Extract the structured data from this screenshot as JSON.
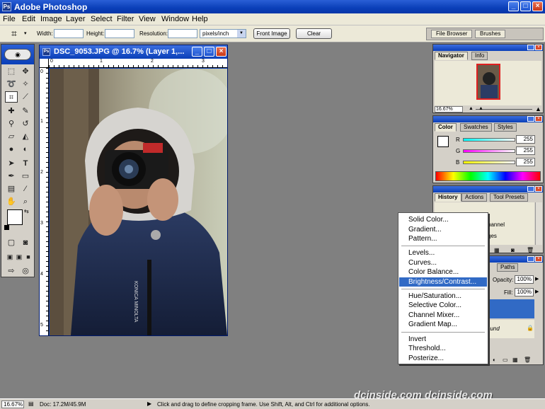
{
  "app": {
    "title": "Adobe Photoshop",
    "icon_text": "Ps"
  },
  "window_controls": {
    "minimize": "_",
    "maximize": "□",
    "close": "×"
  },
  "menu": [
    "File",
    "Edit",
    "Image",
    "Layer",
    "Select",
    "Filter",
    "View",
    "Window",
    "Help"
  ],
  "options": {
    "width_label": "Width:",
    "width_value": "",
    "height_label": "Height:",
    "height_value": "",
    "resolution_label": "Resolution:",
    "resolution_value": "",
    "units_selected": "pixels/inch",
    "front_image_label": "Front Image",
    "clear_label": "Clear",
    "well_tabs": [
      "File Browser",
      "Brushes"
    ]
  },
  "document": {
    "title": "DSC_9053.JPG @ 16.7% (Layer 1,...",
    "ruler_h": [
      "0",
      "1",
      "2",
      "3"
    ],
    "ruler_v": [
      "0",
      "1",
      "2",
      "3",
      "4",
      "5"
    ]
  },
  "navigator": {
    "tabs": [
      "Navigator",
      "Info"
    ],
    "zoom": "16.67%"
  },
  "color": {
    "tabs": [
      "Color",
      "Swatches",
      "Styles"
    ],
    "r_label": "R",
    "g_label": "G",
    "b_label": "B",
    "r": "255",
    "g": "255",
    "b": "255"
  },
  "history": {
    "tabs": [
      "History",
      "Actions",
      "Tool Presets"
    ],
    "rows": [
      "hannel",
      "ges"
    ]
  },
  "layers": {
    "tabs": [
      "Paths"
    ],
    "opacity_label": "Opacity:",
    "opacity": "100%",
    "fill_label": "Fill:",
    "fill": "100%",
    "bg_label": "ound"
  },
  "adjustment_menu": {
    "groups": [
      [
        "Solid Color...",
        "Gradient...",
        "Pattern..."
      ],
      [
        "Levels...",
        "Curves...",
        "Color Balance...",
        "Brightness/Contrast..."
      ],
      [
        "Hue/Saturation...",
        "Selective Color...",
        "Channel Mixer...",
        "Gradient Map..."
      ],
      [
        "Invert",
        "Threshold...",
        "Posterize..."
      ]
    ],
    "highlighted": "Brightness/Contrast..."
  },
  "status": {
    "zoom": "16.67%",
    "doc": "Doc: 17.2M/45.9M",
    "arrow": "▶",
    "hint": "Click and drag to define cropping frame. Use Shift, Alt, and Ctrl for additional options."
  },
  "watermark": "dcinside.com dcinside.com",
  "photo_text": "KONICA MINOLTA",
  "colors": {
    "title_blue": "#0a3fb8",
    "highlight": "#316ac5",
    "workspace": "#808080"
  }
}
